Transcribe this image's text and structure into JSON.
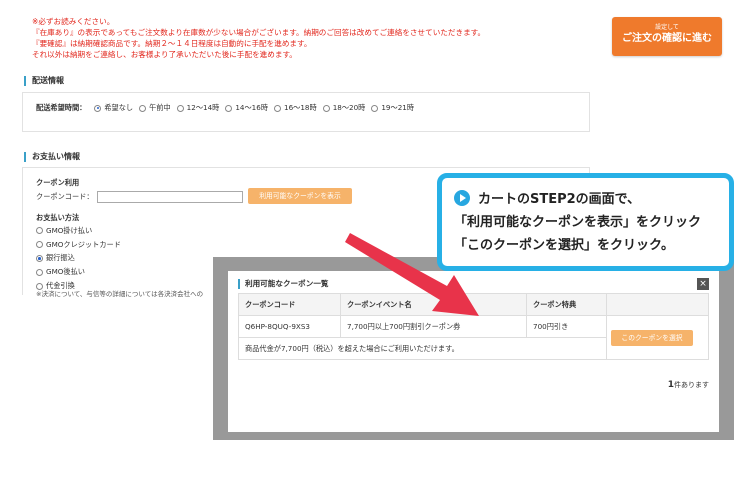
{
  "notes": [
    "※必ずお読みください。",
    "『在庫あり』の表示であってもご注文数より在庫数が少ない場合がございます。納期のご回答は改めてご連絡をさせていただきます。",
    "『要確認』は納期確認商品です。納期２～１４日程度は自動的に手配を進めます。",
    "それ以外は納期をご連絡し、お客様より了承いただいた後に手配を進めます。"
  ],
  "confirm_button": {
    "small": "設定して",
    "big": "ご注文の確認に進む"
  },
  "delivery": {
    "section_title": "配送情報",
    "label": "配送希望時間：",
    "options": [
      "希望なし",
      "午前中",
      "12～14時",
      "14～16時",
      "16～18時",
      "18～20時",
      "19～21時"
    ],
    "selected_index": 0
  },
  "payment": {
    "section_title": "お支払い情報",
    "coupon_label": "クーポン利用",
    "coupon_code_label": "クーポンコード：",
    "coupon_code_value": "",
    "show_coupons_button": "利用可能なクーポンを表示",
    "method_label": "お支払い方法",
    "methods": [
      "GMO掛け払い",
      "GMOクレジットカード",
      "銀行振込",
      "GMO後払い",
      "代金引換"
    ],
    "selected_index": 2,
    "note": "※決済について、与信等の詳細については各決済会社への"
  },
  "modal": {
    "title": "利用可能なクーポン一覧",
    "close": "×",
    "headers": [
      "クーポンコード",
      "クーポンイベント名",
      "クーポン特典",
      ""
    ],
    "row": {
      "code": "Q6HP-8QUQ-9XS3",
      "event": "7,700円以上700円割引クーポン券",
      "benefit": "700円引き",
      "select_button": "このクーポンを選択",
      "condition": "商品代金が7,700円（税込）を超えた場合にご利用いただけます。"
    },
    "count_number": "1",
    "count_suffix": "件あります"
  },
  "callout": {
    "line1": "カートのSTEP2の画面で、",
    "line2": "「利用可能なクーポンを表示」をクリック",
    "line3": "「このクーポンを選択」をクリック。"
  },
  "colors": {
    "accent_orange": "#ef7a2c",
    "light_orange": "#f6b36a",
    "callout_blue": "#27b0e6",
    "warning_red": "#e2281e",
    "arrow_red": "#e8334a"
  }
}
